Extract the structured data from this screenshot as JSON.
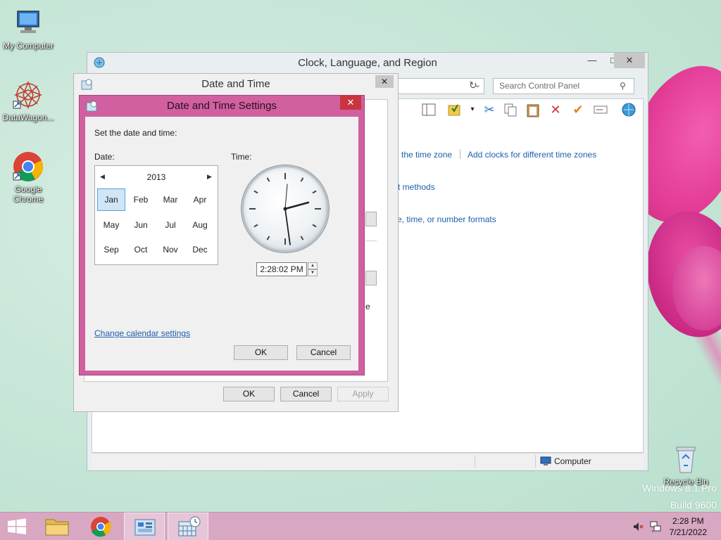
{
  "desktop": {
    "icons": [
      {
        "label": "My Computer"
      },
      {
        "label": "DataWagon..."
      },
      {
        "label": "Google Chrome"
      },
      {
        "label": "Recycle Bin"
      }
    ],
    "watermark_line1": "Windows 8.1 Pro",
    "watermark_line2": "Build 9600"
  },
  "control_panel": {
    "title": "Clock, Language, and Region",
    "search_placeholder": "Search Control Panel",
    "links": {
      "time_zone": "the time zone",
      "add_clocks": "Add clocks for different time zones",
      "input_methods": "t methods",
      "formats": "e, time, or number formats",
      "fragment_e": "e"
    },
    "status_location": "Computer"
  },
  "date_time": {
    "title": "Date and Time",
    "ok": "OK",
    "cancel": "Cancel",
    "apply": "Apply"
  },
  "settings": {
    "title": "Date and Time Settings",
    "instruction": "Set the date and time:",
    "date_label": "Date:",
    "time_label": "Time:",
    "year": "2013",
    "months": [
      "Jan",
      "Feb",
      "Mar",
      "Apr",
      "May",
      "Jun",
      "Jul",
      "Aug",
      "Sep",
      "Oct",
      "Nov",
      "Dec"
    ],
    "selected_month": "Jan",
    "time_value": "2:28:02 PM",
    "change_calendar": "Change calendar settings",
    "ok": "OK",
    "cancel": "Cancel"
  },
  "taskbar": {
    "time": "2:28 PM",
    "date": "7/21/2022"
  },
  "colors": {
    "accent": "#d060a0",
    "taskbar": "#d8a7c2",
    "link": "#1e5fae",
    "selection": "#cfe6f6"
  }
}
